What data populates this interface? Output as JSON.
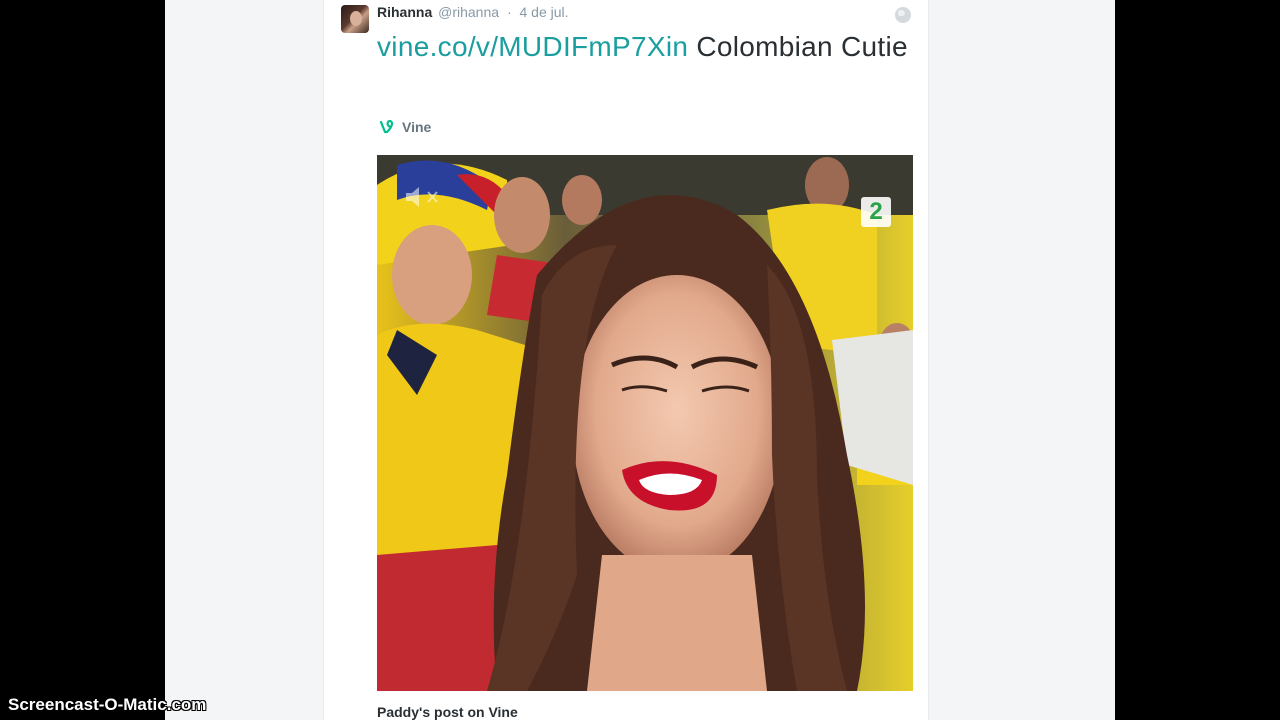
{
  "tweet": {
    "author_name": "Rihanna",
    "author_handle": "@rihanna",
    "separator": "·",
    "date": "4 de jul.",
    "link_text": "vine.co/v/MUDIFmP7Xin",
    "text_after_link": " Colombian Cutie",
    "source_label": "Vine",
    "card_title": "Paddy's post on Vine"
  },
  "media": {
    "channel_badge": "2",
    "mute_icon": "speaker-mute-icon"
  },
  "icons": {
    "globe": "globe-icon",
    "vine": "vine-icon"
  },
  "watermark": "Screencast-O-Matic.com",
  "colors": {
    "link": "#1b9e9f",
    "vine_green": "#00bf8f",
    "text": "#292f33",
    "muted": "#8899a6"
  }
}
